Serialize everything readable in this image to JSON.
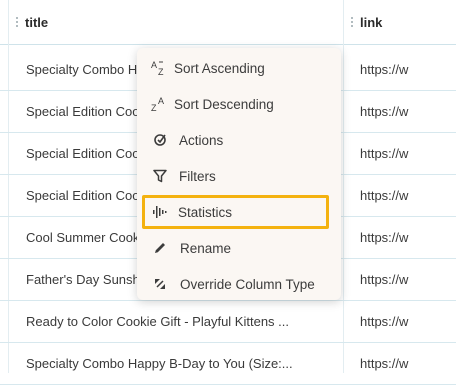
{
  "table": {
    "columns": [
      {
        "label": "title"
      },
      {
        "label": "link"
      }
    ],
    "rows": [
      {
        "title": "Specialty Combo Happy B-Day to You (Size:",
        "link": "https://w"
      },
      {
        "title": "Special Edition Cookie Gift Box",
        "link": "https://w"
      },
      {
        "title": "Special Edition Cookie Gift Box",
        "link": "https://w"
      },
      {
        "title": "Special Edition Cookie Gift Box",
        "link": "https://w"
      },
      {
        "title": "Cool Summer Cookie Gift Box",
        "link": "https://w"
      },
      {
        "title": "Father's Day Sunshine Cookie Gift",
        "link": "https://w"
      },
      {
        "title": "Ready to Color Cookie Gift - Playful Kittens ...",
        "link": "https://w"
      },
      {
        "title": "Specialty Combo Happy B-Day to You (Size:...",
        "link": "https://w"
      }
    ]
  },
  "context_menu": {
    "items": [
      {
        "label": "Sort Ascending",
        "icon": "sort-az-icon"
      },
      {
        "label": "Sort Descending",
        "icon": "sort-za-icon"
      },
      {
        "label": "Actions",
        "icon": "actions-icon"
      },
      {
        "label": "Filters",
        "icon": "filter-icon"
      },
      {
        "label": "Statistics",
        "icon": "statistics-icon"
      },
      {
        "label": "Rename",
        "icon": "pencil-icon"
      },
      {
        "label": "Override Column Type",
        "icon": "override-type-icon"
      }
    ],
    "highlighted": "Statistics",
    "highlight_color": "#f4b20f"
  }
}
